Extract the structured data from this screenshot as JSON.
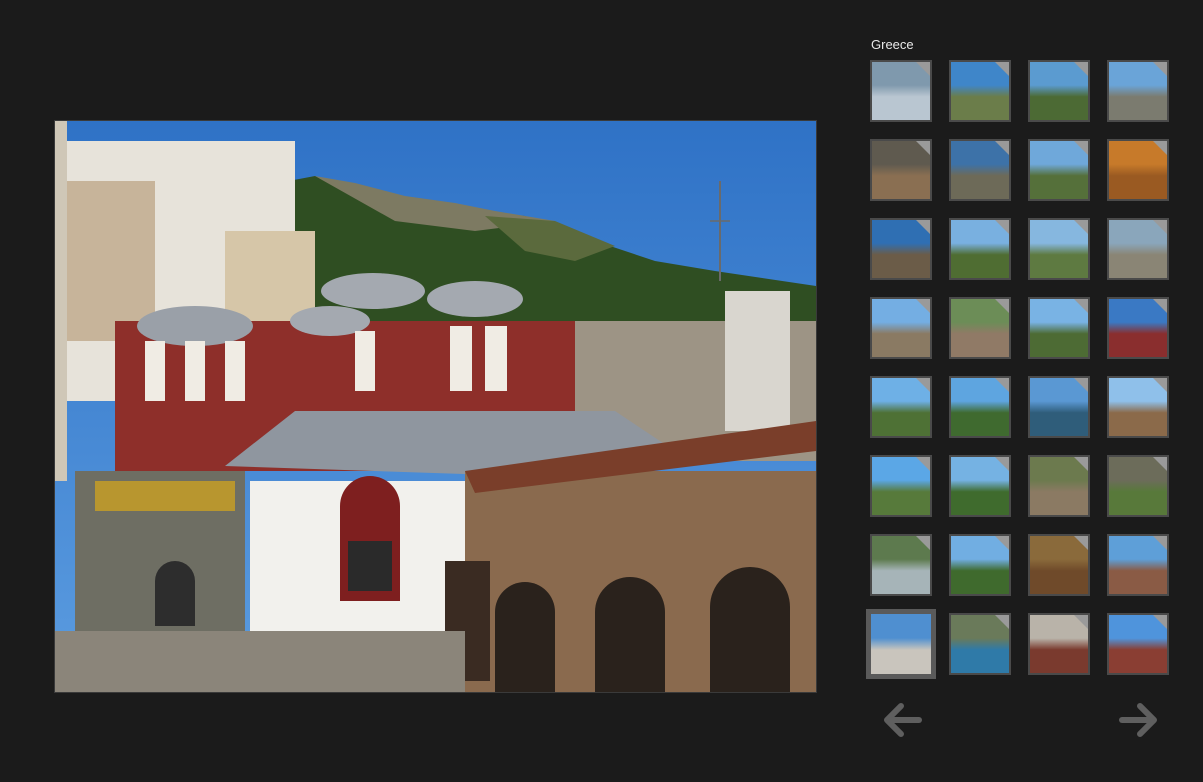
{
  "gallery": {
    "title": "Greece"
  },
  "viewer": {
    "image_icon": "monastery-photo"
  },
  "thumbnails": [
    {
      "sky": "#7f99ad",
      "ground": "#b9c6d1"
    },
    {
      "sky": "#3f86c9",
      "ground": "#6b7d4a"
    },
    {
      "sky": "#5b9bd0",
      "ground": "#4c6a34"
    },
    {
      "sky": "#6aa4d8",
      "ground": "#7b7b6f"
    },
    {
      "sky": "#5f5a4f",
      "ground": "#8a6f52"
    },
    {
      "sky": "#3d72a8",
      "ground": "#6d6a58"
    },
    {
      "sky": "#6fa8da",
      "ground": "#55703a"
    },
    {
      "sky": "#c77a2a",
      "ground": "#9a5a22"
    },
    {
      "sky": "#2f6fb3",
      "ground": "#6b5c48"
    },
    {
      "sky": "#79b0e0",
      "ground": "#4f6d32"
    },
    {
      "sky": "#86b7df",
      "ground": "#5e7a41"
    },
    {
      "sky": "#8aa6bb",
      "ground": "#8a8575"
    },
    {
      "sky": "#74aee3",
      "ground": "#8a7a63"
    },
    {
      "sky": "#6c8d57",
      "ground": "#907a66"
    },
    {
      "sky": "#79b3e4",
      "ground": "#4d6b34"
    },
    {
      "sky": "#3a79c4",
      "ground": "#8a2e2e"
    },
    {
      "sky": "#6eb0e6",
      "ground": "#4e7135"
    },
    {
      "sky": "#5ea5e0",
      "ground": "#3f6a2f"
    },
    {
      "sky": "#5a98d3",
      "ground": "#2f5d7a"
    },
    {
      "sky": "#8fc0ea",
      "ground": "#8b6a4a"
    },
    {
      "sky": "#5ba7e6",
      "ground": "#577a3b"
    },
    {
      "sky": "#75b2e3",
      "ground": "#3f6b2d"
    },
    {
      "sky": "#6c7a4e",
      "ground": "#8b7a63"
    },
    {
      "sky": "#6c6c5a",
      "ground": "#58793a"
    },
    {
      "sky": "#5d7a4e",
      "ground": "#a6b4b8"
    },
    {
      "sky": "#71aee2",
      "ground": "#3f6a2d"
    },
    {
      "sky": "#8a6a3b",
      "ground": "#6f4a2a"
    },
    {
      "sky": "#5e9fd8",
      "ground": "#8a5b45"
    },
    {
      "sky": "#4f8fd0",
      "ground": "#c9c5bd"
    },
    {
      "sky": "#6a7a5a",
      "ground": "#2f7aa8"
    },
    {
      "sky": "#b9b3a9",
      "ground": "#7a3a2e"
    },
    {
      "sky": "#4f94dc",
      "ground": "#8a3e33"
    }
  ],
  "selected_index": 28,
  "controls": {
    "prev_icon": "arrow-left-icon",
    "next_icon": "arrow-right-icon"
  }
}
